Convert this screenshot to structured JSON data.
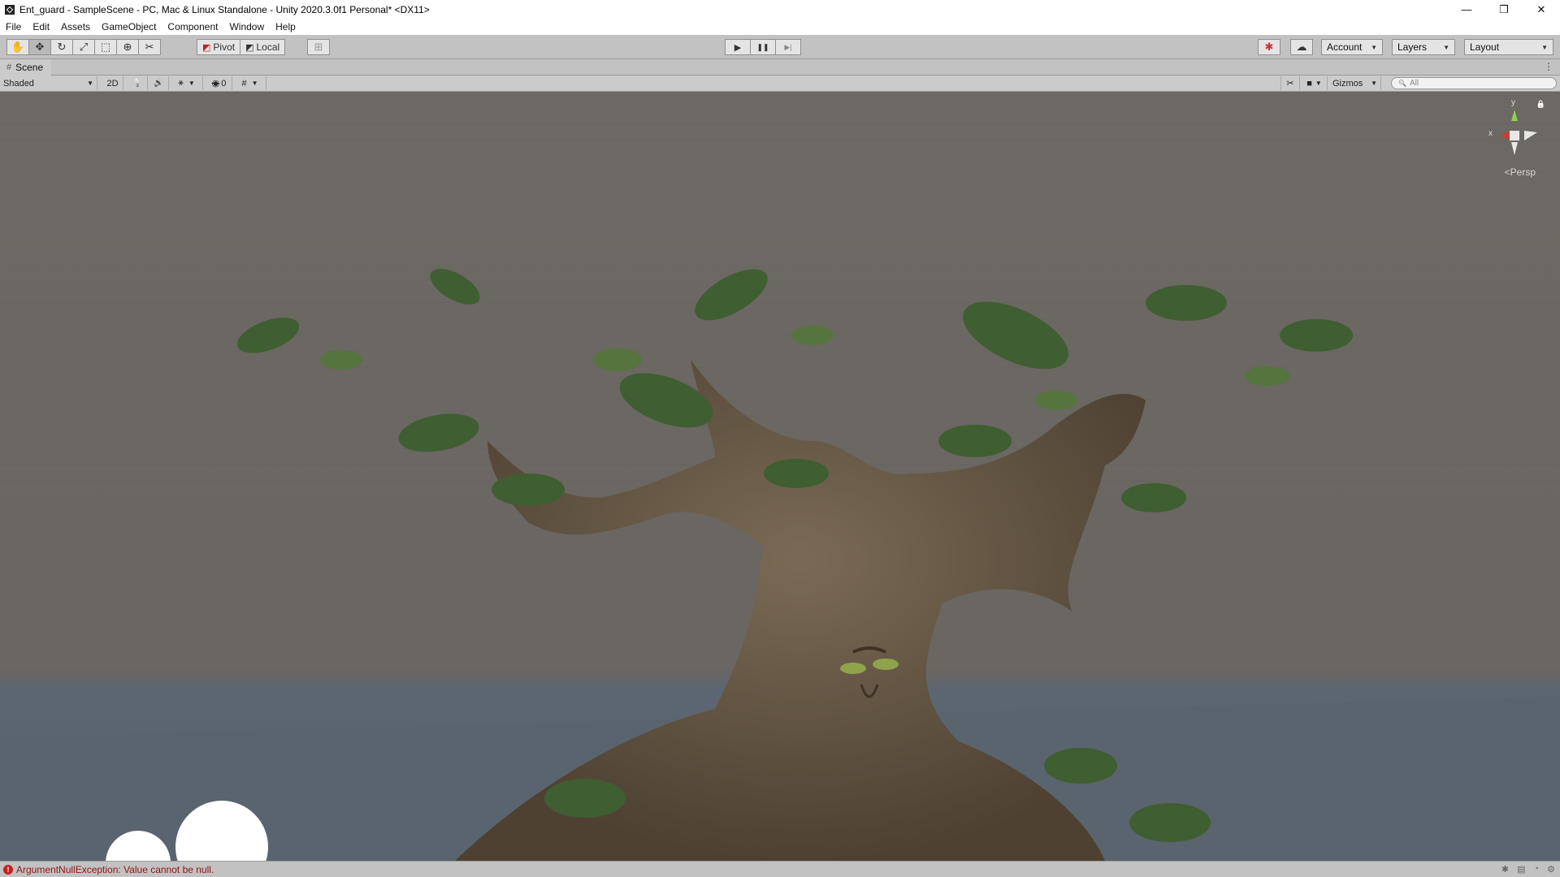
{
  "window": {
    "title": "Ent_guard - SampleScene - PC, Mac & Linux Standalone - Unity 2020.3.0f1 Personal* <DX11>",
    "controls": [
      "—",
      "❐",
      "✕"
    ]
  },
  "menu": [
    "File",
    "Edit",
    "Assets",
    "GameObject",
    "Component",
    "Window",
    "Help"
  ],
  "toolbar": {
    "tools": [
      {
        "name": "hand-tool",
        "icon": "✋"
      },
      {
        "name": "move-tool",
        "icon": "✥"
      },
      {
        "name": "rotate-tool",
        "icon": "↻"
      },
      {
        "name": "scale-tool",
        "icon": "⤢"
      },
      {
        "name": "rect-tool",
        "icon": "⬚"
      },
      {
        "name": "transform-tool",
        "icon": "⊕"
      },
      {
        "name": "custom-tool",
        "icon": "✂"
      }
    ],
    "pivot_label": "Pivot",
    "local_label": "Local",
    "snap_icon": "⊞",
    "play_icon": "▶",
    "pause_icon": "❚❚",
    "step_icon": "▶|",
    "collab_icon": "✱",
    "cloud_icon": "☁",
    "account_label": "Account",
    "layers_label": "Layers",
    "layout_label": "Layout"
  },
  "scene_tab": {
    "icon": "#",
    "label": "Scene",
    "kebab": "⋮"
  },
  "scene_toolbar": {
    "shading_mode": "Shaded",
    "mode_2d": "2D",
    "light_icon": "💡",
    "audio_icon": "🔊",
    "fx_icon": "⚹",
    "hidden_count": "0",
    "grid_icon": "#",
    "tools_icon": "✂",
    "camera_icon": "■",
    "gizmos_label": "Gizmos",
    "search_placeholder": "All",
    "search_icon": "🔍"
  },
  "gizmo": {
    "y_label": "y",
    "x_label": "x",
    "lock_icon": "🔒",
    "projection_label": "Persp",
    "projection_prefix": "<"
  },
  "status": {
    "error_icon": "!",
    "message": "ArgumentNullException: Value cannot be null."
  },
  "colors": {
    "sky": "#6b6762",
    "ground": "#5b6670",
    "bark": "#6a5a48",
    "leaf": "#3f5e31",
    "error": "#8d1414"
  }
}
